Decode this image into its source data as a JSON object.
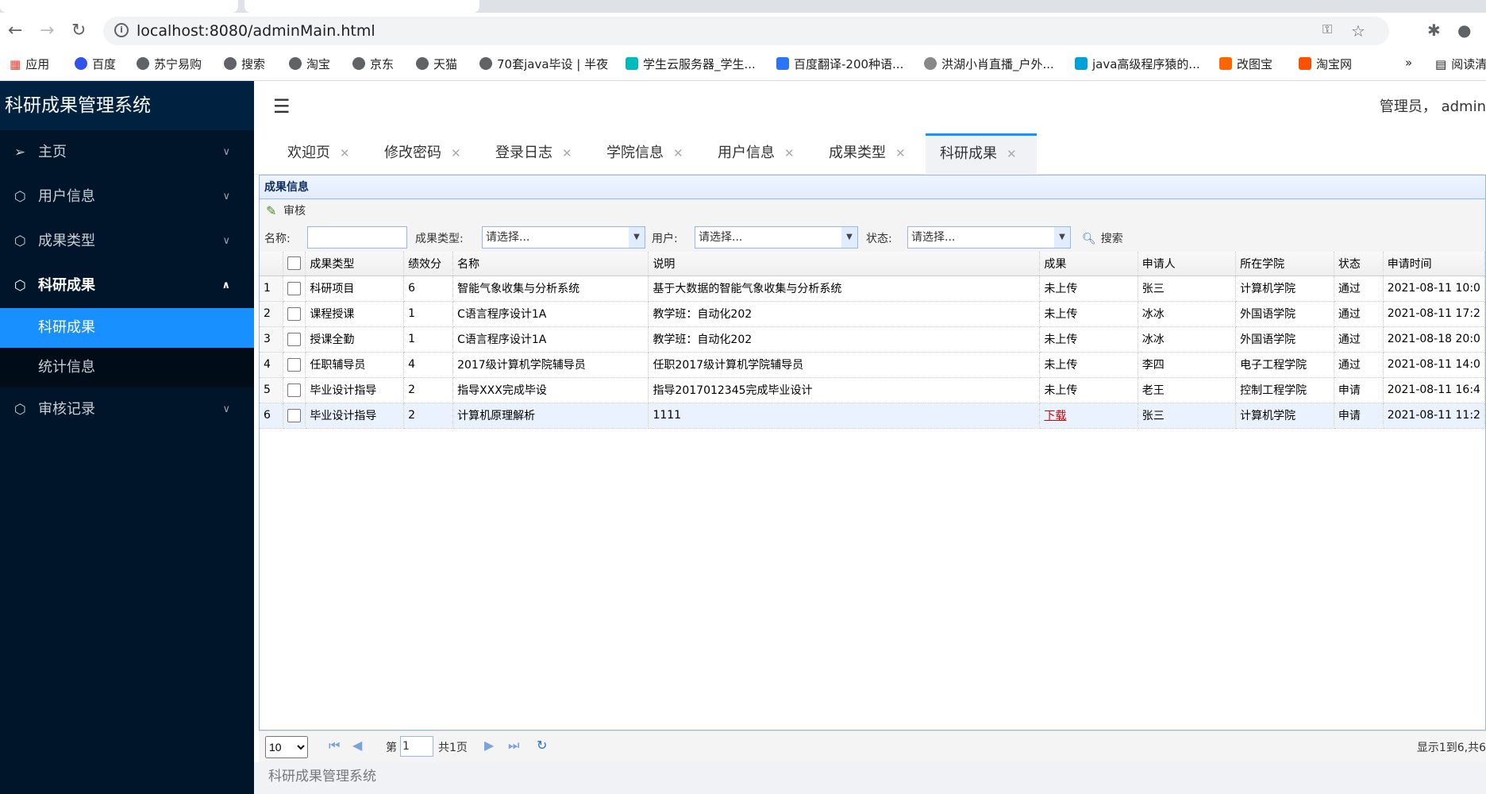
{
  "browser": {
    "url": "localhost:8080/adminMain.html",
    "bookmarks": [
      "应用",
      "百度",
      "苏宁易购",
      "搜索",
      "淘宝",
      "京东",
      "天猫",
      "70套java毕设 | 半夜",
      "学生云服务器_学生...",
      "百度翻译-200种语...",
      "洪湖小肖直播_户外...",
      "java高级程序猿的...",
      "改图宝",
      "淘宝网",
      "阅读清单"
    ],
    "more": "»"
  },
  "sidebar": {
    "logo": "科研成果管理系统",
    "items": [
      {
        "label": "主页"
      },
      {
        "label": "用户信息"
      },
      {
        "label": "成果类型"
      },
      {
        "label": "科研成果"
      },
      {
        "label": "审核记录"
      }
    ],
    "submenu": [
      {
        "label": "科研成果"
      },
      {
        "label": "统计信息"
      }
    ]
  },
  "header": {
    "user": "管理员， admin"
  },
  "tabs": [
    "欢迎页",
    "修改密码",
    "登录日志",
    "学院信息",
    "用户信息",
    "成果类型",
    "科研成果"
  ],
  "panel": {
    "title": "成果信息",
    "audit_label": "审核",
    "search": {
      "name_label": "名称:",
      "type_label": "成果类型:",
      "user_label": "用户:",
      "status_label": "状态:",
      "placeholder": "请选择...",
      "search_label": "搜索"
    }
  },
  "table": {
    "columns": [
      "成果类型",
      "绩效分",
      "名称",
      "说明",
      "成果",
      "申请人",
      "所在学院",
      "状态",
      "申请时间"
    ],
    "rows": [
      {
        "n": "1",
        "type": "科研项目",
        "score": "6",
        "name": "智能气象收集与分析系统",
        "desc": "基于大数据的智能气象收集与分析系统",
        "result": "未上传",
        "applicant": "张三",
        "college": "计算机学院",
        "status": "通过",
        "time": "2021-08-11 10:0"
      },
      {
        "n": "2",
        "type": "课程授课",
        "score": "1",
        "name": "C语言程序设计1A",
        "desc": "教学班：自动化202",
        "result": "未上传",
        "applicant": "冰冰",
        "college": "外国语学院",
        "status": "通过",
        "time": "2021-08-11 17:2"
      },
      {
        "n": "3",
        "type": "授课全勤",
        "score": "1",
        "name": "C语言程序设计1A",
        "desc": "教学班：自动化202",
        "result": "未上传",
        "applicant": "冰冰",
        "college": "外国语学院",
        "status": "通过",
        "time": "2021-08-18 20:0"
      },
      {
        "n": "4",
        "type": "任职辅导员",
        "score": "4",
        "name": "2017级计算机学院辅导员",
        "desc": "任职2017级计算机学院辅导员",
        "result": "未上传",
        "applicant": "李四",
        "college": "电子工程学院",
        "status": "通过",
        "time": "2021-08-11 14:0"
      },
      {
        "n": "5",
        "type": "毕业设计指导",
        "score": "2",
        "name": "指导XXX完成毕设",
        "desc": "指导2017012345完成毕业设计",
        "result": "未上传",
        "applicant": "老王",
        "college": "控制工程学院",
        "status": "申请",
        "time": "2021-08-11 16:4"
      },
      {
        "n": "6",
        "type": "毕业设计指导",
        "score": "2",
        "name": "计算机原理解析",
        "desc": "1111",
        "result": "下载",
        "applicant": "张三",
        "college": "计算机学院",
        "status": "申请",
        "time": "2021-08-11 11:2"
      }
    ]
  },
  "pager": {
    "page_size": "10",
    "page_prefix": "第",
    "page": "1",
    "total_pages": "共1页",
    "summary": "显示1到6,共6"
  },
  "footer": "科研成果管理系统"
}
